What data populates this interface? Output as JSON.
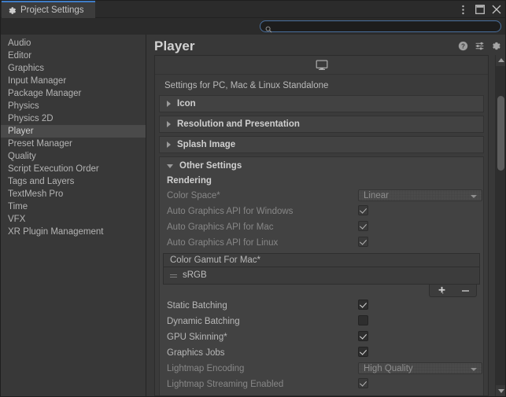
{
  "window": {
    "tab_label": "Project Settings",
    "tab_icon": "gear-icon",
    "controls": {
      "menu_label": "⋮",
      "maximize_label": "□",
      "close_label": "✕"
    }
  },
  "search": {
    "value": "",
    "placeholder": "",
    "icon": "search-icon"
  },
  "sidebar": {
    "items": [
      {
        "label": "Audio",
        "selected": false
      },
      {
        "label": "Editor",
        "selected": false
      },
      {
        "label": "Graphics",
        "selected": false
      },
      {
        "label": "Input Manager",
        "selected": false
      },
      {
        "label": "Package Manager",
        "selected": false
      },
      {
        "label": "Physics",
        "selected": false
      },
      {
        "label": "Physics 2D",
        "selected": false
      },
      {
        "label": "Player",
        "selected": true
      },
      {
        "label": "Preset Manager",
        "selected": false
      },
      {
        "label": "Quality",
        "selected": false
      },
      {
        "label": "Script Execution Order",
        "selected": false
      },
      {
        "label": "Tags and Layers",
        "selected": false
      },
      {
        "label": "TextMesh Pro",
        "selected": false
      },
      {
        "label": "Time",
        "selected": false
      },
      {
        "label": "VFX",
        "selected": false
      },
      {
        "label": "XR Plugin Management",
        "selected": false
      }
    ]
  },
  "panel": {
    "title": "Player",
    "tools": [
      {
        "name": "help-icon",
        "label": "?"
      },
      {
        "name": "preset-icon",
        "label": ""
      },
      {
        "name": "gear-icon",
        "label": ""
      }
    ],
    "platform_tab_icon": "standalone-monitor-icon",
    "settings_for": "Settings for PC, Mac & Linux Standalone",
    "foldouts": [
      {
        "label": "Icon",
        "open": false
      },
      {
        "label": "Resolution and Presentation",
        "open": false
      },
      {
        "label": "Splash Image",
        "open": false
      }
    ],
    "other_settings": {
      "label": "Other Settings",
      "open": true,
      "rendering_header": "Rendering",
      "rows": [
        {
          "label": "Color Space*",
          "type": "dropdown",
          "value": "Linear",
          "dimmed": true
        },
        {
          "label": "Auto Graphics API  for Windows",
          "type": "checkbox",
          "checked": true,
          "dimmed": true
        },
        {
          "label": "Auto Graphics API  for Mac",
          "type": "checkbox",
          "checked": true,
          "dimmed": true
        },
        {
          "label": "Auto Graphics API  for Linux",
          "type": "checkbox",
          "checked": true,
          "dimmed": true
        }
      ],
      "color_gamut": {
        "header": "Color Gamut For Mac*",
        "items": [
          {
            "label": "sRGB"
          }
        ],
        "add_label": "+",
        "remove_label": "−"
      },
      "rows2": [
        {
          "label": "Static Batching",
          "type": "checkbox",
          "checked": true,
          "dimmed": false
        },
        {
          "label": "Dynamic Batching",
          "type": "checkbox",
          "checked": false,
          "dimmed": false
        },
        {
          "label": "GPU Skinning*",
          "type": "checkbox",
          "checked": true,
          "dimmed": false
        },
        {
          "label": "Graphics Jobs",
          "type": "checkbox",
          "checked": true,
          "dimmed": false
        },
        {
          "label": "Lightmap Encoding",
          "type": "dropdown",
          "value": "High Quality",
          "dimmed": true
        },
        {
          "label": "Lightmap Streaming Enabled",
          "type": "checkbox",
          "checked": true,
          "dimmed": true
        }
      ]
    }
  },
  "scrollbar": {
    "up_arrow": "▲",
    "down_arrow": "▼"
  },
  "colors": {
    "window_bg": "#383838",
    "tab_accent": "#3f7cc6",
    "selection": "#4a4a4a",
    "panel_bg": "#3b3b3b",
    "foldout_bg": "#424242",
    "text": "#b8b8b8",
    "text_dim": "#878787"
  }
}
